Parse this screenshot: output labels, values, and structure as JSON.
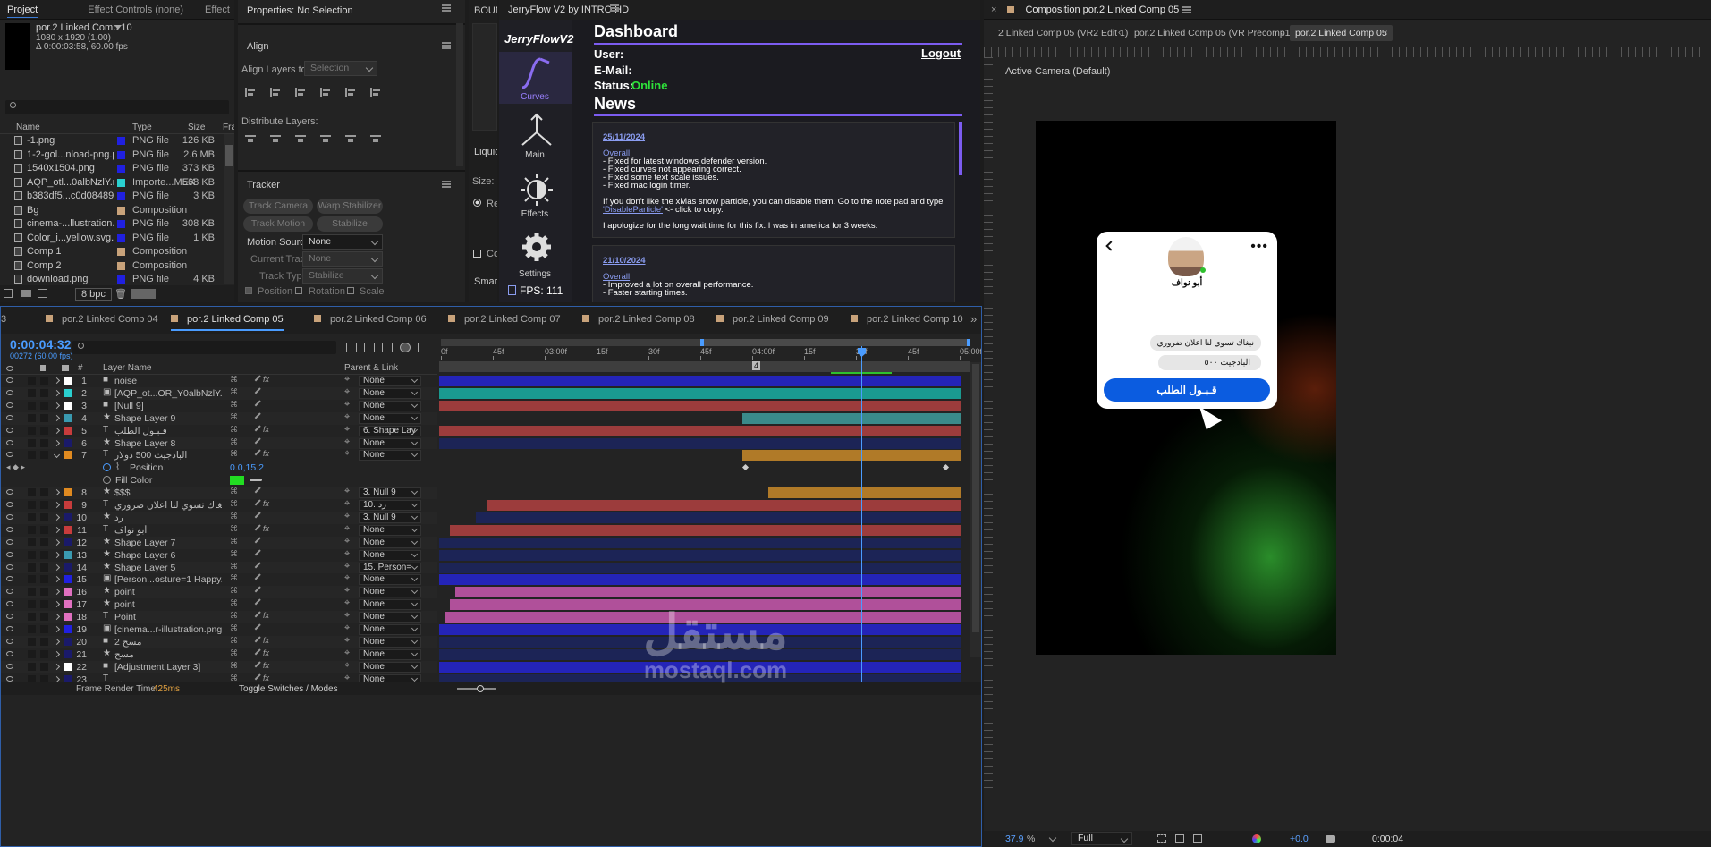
{
  "project": {
    "tabs": [
      "Project",
      "Effect Controls (none)",
      "Effect"
    ],
    "comp_name": "por.2 Linked Comp 10",
    "comp_size": "1080 x 1920 (1.00)",
    "comp_dur": "Δ 0:00:03:58, 60.00 fps",
    "columns": [
      "Name",
      "Type",
      "Size",
      "Fra"
    ],
    "items": [
      {
        "name": "-1.png",
        "type": "PNG file",
        "size": "126 KB",
        "color": "#2020e0"
      },
      {
        "name": "1-2-gol...nload-png.png",
        "type": "PNG file",
        "size": "2.6 MB",
        "color": "#2020e0"
      },
      {
        "name": "1540x1504.png",
        "type": "PNG file",
        "size": "373 KB",
        "color": "#2020e0"
      },
      {
        "name": "AQP_otl...0albNzlY.mp4",
        "type": "Importe...MEX",
        "size": "568 KB",
        "color": "#2ad0d0"
      },
      {
        "name": "b383df5...c0d08489.png",
        "type": "PNG file",
        "size": "3 KB",
        "color": "#2020e0"
      },
      {
        "name": "Bg",
        "type": "Composition",
        "size": "",
        "color": "#c8a27a"
      },
      {
        "name": "cinema-...llustration.png",
        "type": "PNG file",
        "size": "308 KB",
        "color": "#2020e0"
      },
      {
        "name": "Color_i...yellow.svg.png",
        "type": "PNG file",
        "size": "1 KB",
        "color": "#2020e0"
      },
      {
        "name": "Comp 1",
        "type": "Composition",
        "size": "",
        "color": "#c8a27a"
      },
      {
        "name": "Comp 2",
        "type": "Composition",
        "size": "",
        "color": "#c8a27a"
      },
      {
        "name": "download.png",
        "type": "PNG file",
        "size": "4 KB",
        "color": "#2020e0"
      }
    ],
    "bpc": "8 bpc"
  },
  "properties": {
    "title": "Properties: No Selection",
    "align": "Align",
    "align_to_label": "Align Layers to:",
    "align_to_value": "Selection",
    "distribute": "Distribute Layers:",
    "tracker": "Tracker",
    "track_camera": "Track Camera",
    "warp": "Warp Stabilizer",
    "track_motion": "Track Motion",
    "stabilize": "Stabilize Motion",
    "motion_source_label": "Motion Source:",
    "motion_source": "None",
    "current_track_label": "Current Track:",
    "current_track": "None",
    "track_type_label": "Track Type:",
    "track_type": "Stabilize",
    "position": "Position",
    "rotation": "Rotation",
    "scale": "Scale"
  },
  "mid": {
    "tab": "BOUN",
    "liquid": "Liquid",
    "size": "Size:",
    "re": "Re",
    "co": "Co",
    "smart": "Smart"
  },
  "jerry": {
    "tab": "JerryFlow V2 by INTRO HD",
    "logo": "JerryFlowV2",
    "nav": [
      {
        "label": "Curves",
        "icon": "curves-icon"
      },
      {
        "label": "Main",
        "icon": "main-icon"
      },
      {
        "label": "Effects",
        "icon": "effects-icon"
      },
      {
        "label": "Settings",
        "icon": "gear-icon"
      }
    ],
    "fps": "FPS: 111",
    "title": "Dashboard",
    "logout": "Logout",
    "user": "User:",
    "email": "E-Mail:",
    "status_label": "Status:",
    "status": "Online",
    "news": "News",
    "post1_date": "25/11/2024",
    "post1_head": "Overall",
    "post1_lines": [
      "- Fixed for latest windows defender version.",
      "- Fixed curves not appearing correct.",
      "- Fixed some text scale issues.",
      "- Fixed mac login timer."
    ],
    "post1_p1": "If you don't like the xMas snow particle, you can disable them. Go to the note pad and type",
    "post1_link": "'DisableParticle'",
    "post1_p1b": " <- click to copy.",
    "post1_p2": "I apologize for the long wait time for this fix. I was in america for 3 weeks.",
    "post2_date": "21/10/2024",
    "post2_head": "Overall",
    "post2_lines": [
      "- Improved a lot on overall performance.",
      "- Faster starting times."
    ]
  },
  "comp": {
    "tab": "Composition por.2 Linked Comp 05",
    "breadcrumbs": [
      "2 Linked Comp 05 (VR2 Edit 1)",
      "por.2 Linked Comp 05 (VR Precomp1)",
      "por.2 Linked Comp 05"
    ],
    "camera": "Active Camera (Default)",
    "zoom": "37.9",
    "zoom_unit": "%",
    "res": "Full",
    "exposure": "+0.0",
    "time": "0:00:04",
    "chat": {
      "name": "أبو نواف",
      "msg1": "نبغاك تسوي لنا اعلان ضروري",
      "msg2": "البادجيت ٥٠٠",
      "accept": "قـبـول الطلب"
    }
  },
  "timeline": {
    "tabs": [
      "3",
      "por.2 Linked Comp 04",
      "por.2 Linked Comp 05",
      "por.2 Linked Comp 06",
      "por.2 Linked Comp 07",
      "por.2 Linked Comp 08",
      "por.2 Linked Comp 09",
      "por.2 Linked Comp 10"
    ],
    "timecode": "0:00:04:32",
    "frames": "00272 (60.00 fps)",
    "layer_name_header": "Layer Name",
    "parent_header": "Parent & Link",
    "ruler": [
      "0f",
      "45f",
      "03:00f",
      "15f",
      "30f",
      "45f",
      "04:00f",
      "15f",
      "30f",
      "45f",
      "05:00f"
    ],
    "marker": "4",
    "render_label": "Frame Render Time:",
    "render_time": "425ms",
    "toggle": "Toggle Switches / Modes",
    "position_label": "Position",
    "position_value": "0.0,15.2",
    "fill_label": "Fill Color",
    "layers": [
      {
        "n": "1",
        "name": "noise",
        "parent": "None",
        "color": "#ffffff",
        "type": "solid",
        "bar": "#2424b8",
        "start": 0,
        "end": 1
      },
      {
        "n": "2",
        "name": "[AQP_ot...OR_Y0albNzlY.mp4]",
        "parent": "None",
        "color": "#2ad0d0",
        "type": "file",
        "bar": "#1a9a90",
        "start": 0,
        "end": 1
      },
      {
        "n": "3",
        "name": "[Null 9]",
        "parent": "None",
        "color": "#ffffff",
        "type": "solid",
        "bar": "#9c3c3c",
        "start": 0,
        "end": 1
      },
      {
        "n": "4",
        "name": "Shape Layer 9",
        "parent": "None",
        "color": "#3a9ab0",
        "type": "shape",
        "bar": "#3a8a8a",
        "start": 0.58,
        "end": 1
      },
      {
        "n": "5",
        "name": "قـبـول الطلب",
        "parent": "6. Shape Lay",
        "color": "#c83c3c",
        "type": "text",
        "bar": "#9c3c3c",
        "start": 0,
        "end": 1
      },
      {
        "n": "6",
        "name": "Shape Layer 8",
        "parent": "None",
        "color": "#1a1a6a",
        "type": "shape",
        "bar": "#1c2456",
        "start": 0,
        "end": 1
      },
      {
        "n": "7",
        "name": "البادجيت 500 دولار",
        "parent": "None",
        "color": "#e08a20",
        "type": "text",
        "bar": "#b07a28",
        "start": 0.58,
        "end": 1
      },
      {
        "n": "8",
        "name": "$$$",
        "parent": "3. Null 9",
        "color": "#e08a20",
        "type": "shape",
        "bar": "#b07a28",
        "start": 0.63,
        "end": 1
      },
      {
        "n": "9",
        "name": "نبغاك تسوي لنا اعلان ضروري",
        "parent": "10. رد",
        "color": "#c83c3c",
        "type": "text",
        "bar": "#9c3c3c",
        "start": 0.09,
        "end": 1
      },
      {
        "n": "10",
        "name": "رد",
        "parent": "3. Null 9",
        "color": "#1a1a6a",
        "type": "shape",
        "bar": "#1c2456",
        "start": 0.07,
        "end": 1
      },
      {
        "n": "11",
        "name": "أبو نواف",
        "parent": "None",
        "color": "#c83c3c",
        "type": "text",
        "bar": "#9c3c3c",
        "start": 0.02,
        "end": 1
      },
      {
        "n": "12",
        "name": "Shape Layer 7",
        "parent": "None",
        "color": "#1a1a6a",
        "type": "shape",
        "bar": "#1c2456",
        "start": 0,
        "end": 1
      },
      {
        "n": "13",
        "name": "Shape Layer 6",
        "parent": "None",
        "color": "#3a9ab0",
        "type": "shape",
        "bar": "#1c2456",
        "start": 0,
        "end": 1
      },
      {
        "n": "14",
        "name": "Shape Layer 5",
        "parent": "15. Person=",
        "color": "#1a1a6a",
        "type": "shape",
        "bar": "#1c2456",
        "start": 0,
        "end": 1
      },
      {
        "n": "15",
        "name": "[Person...osture=1 Happy.png]",
        "parent": "None",
        "color": "#2020e0",
        "type": "file",
        "bar": "#2424b8",
        "start": 0,
        "end": 1
      },
      {
        "n": "16",
        "name": "point",
        "parent": "None",
        "color": "#e070c0",
        "type": "shape",
        "bar": "#b0509a",
        "start": 0.03,
        "end": 1
      },
      {
        "n": "17",
        "name": "point",
        "parent": "None",
        "color": "#e070c0",
        "type": "shape",
        "bar": "#b0509a",
        "start": 0.02,
        "end": 1
      },
      {
        "n": "18",
        "name": "Point",
        "parent": "None",
        "color": "#e070c0",
        "type": "text",
        "bar": "#b0509a",
        "start": 0.01,
        "end": 1
      },
      {
        "n": "19",
        "name": "[cinema...r-illustration.png]",
        "parent": "None",
        "color": "#2020e0",
        "type": "file",
        "bar": "#2424b8",
        "start": 0,
        "end": 1
      },
      {
        "n": "20",
        "name": "مسح 2",
        "parent": "None",
        "color": "#1a1a6a",
        "type": "solid",
        "bar": "#1c2456",
        "start": 0,
        "end": 1
      },
      {
        "n": "21",
        "name": "مسح",
        "parent": "None",
        "color": "#1a1a6a",
        "type": "shape",
        "bar": "#1c2456",
        "start": 0,
        "end": 1
      },
      {
        "n": "22",
        "name": "[Adjustment Layer 3]",
        "parent": "None",
        "color": "#ffffff",
        "type": "solid",
        "bar": "#2424b8",
        "start": 0,
        "end": 1
      },
      {
        "n": "23",
        "name": "...",
        "parent": "None",
        "color": "#1a1a6a",
        "type": "text",
        "bar": "#1c2456",
        "start": 0,
        "end": 1
      }
    ]
  },
  "watermark": {
    "ar": "مستقل",
    "en": "mostaql.com"
  }
}
